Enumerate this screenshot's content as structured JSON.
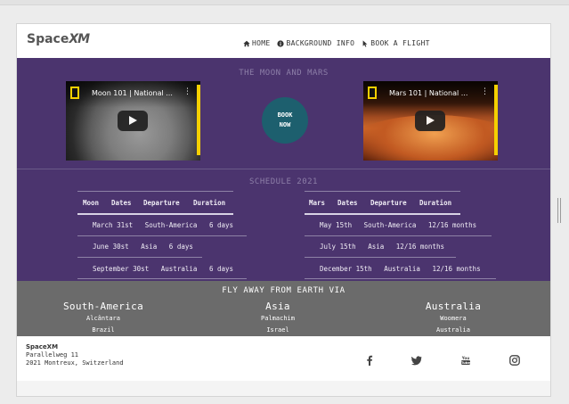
{
  "brand": {
    "logo_text": "Space",
    "logo_mark": "XM"
  },
  "nav": [
    {
      "label": "HOME",
      "icon": "home-icon"
    },
    {
      "label": "BACKGROUND INFO",
      "icon": "info-icon"
    },
    {
      "label": "BOOK A FLIGHT",
      "icon": "cursor-icon"
    }
  ],
  "videos_section": {
    "title": "THE MOON AND MARS",
    "moon_video": {
      "title": "Moon 101 | National ...",
      "menu": "⋮"
    },
    "mars_video": {
      "title": "Mars 101 | National ...",
      "menu": "⋮"
    },
    "book_button": {
      "line1": "BOOK",
      "line2": "NOW"
    }
  },
  "schedule": {
    "title": "SCHEDULE 2021",
    "moon": {
      "headers": [
        "Moon",
        "Dates",
        "Departure",
        "Duration"
      ],
      "rows": [
        [
          "March 31st",
          "South-America",
          "6 days"
        ],
        [
          "June 30st",
          "Asia",
          "6 days"
        ],
        [
          "September 30st",
          "Australia",
          "6 days"
        ]
      ]
    },
    "mars": {
      "headers": [
        "Mars",
        "Dates",
        "Departure",
        "Duration"
      ],
      "rows": [
        [
          "May 15th",
          "South-America",
          "12/16 months"
        ],
        [
          "July 15th",
          "Asia",
          "12/16 months"
        ],
        [
          "December 15th",
          "Australia",
          "12/16 months"
        ]
      ]
    }
  },
  "departures": {
    "title": "FLY AWAY FROM EARTH VIA",
    "locations": [
      {
        "name": "South-America",
        "site": "Alcântara",
        "country": "Brazil"
      },
      {
        "name": "Asia",
        "site": "Palmachim",
        "country": "Israel"
      },
      {
        "name": "Australia",
        "site": "Woomera",
        "country": "Australia"
      }
    ]
  },
  "footer": {
    "logo": "SpaceXM",
    "street": "Parallelweg 11",
    "city": "2021 Montreux, Switzerland",
    "social": [
      "facebook-icon",
      "twitter-icon",
      "youtube-icon",
      "instagram-icon"
    ]
  },
  "colors": {
    "purple": "#4b346e",
    "book_button": "#1d5f6e",
    "grey_band": "#6b6b6b"
  }
}
